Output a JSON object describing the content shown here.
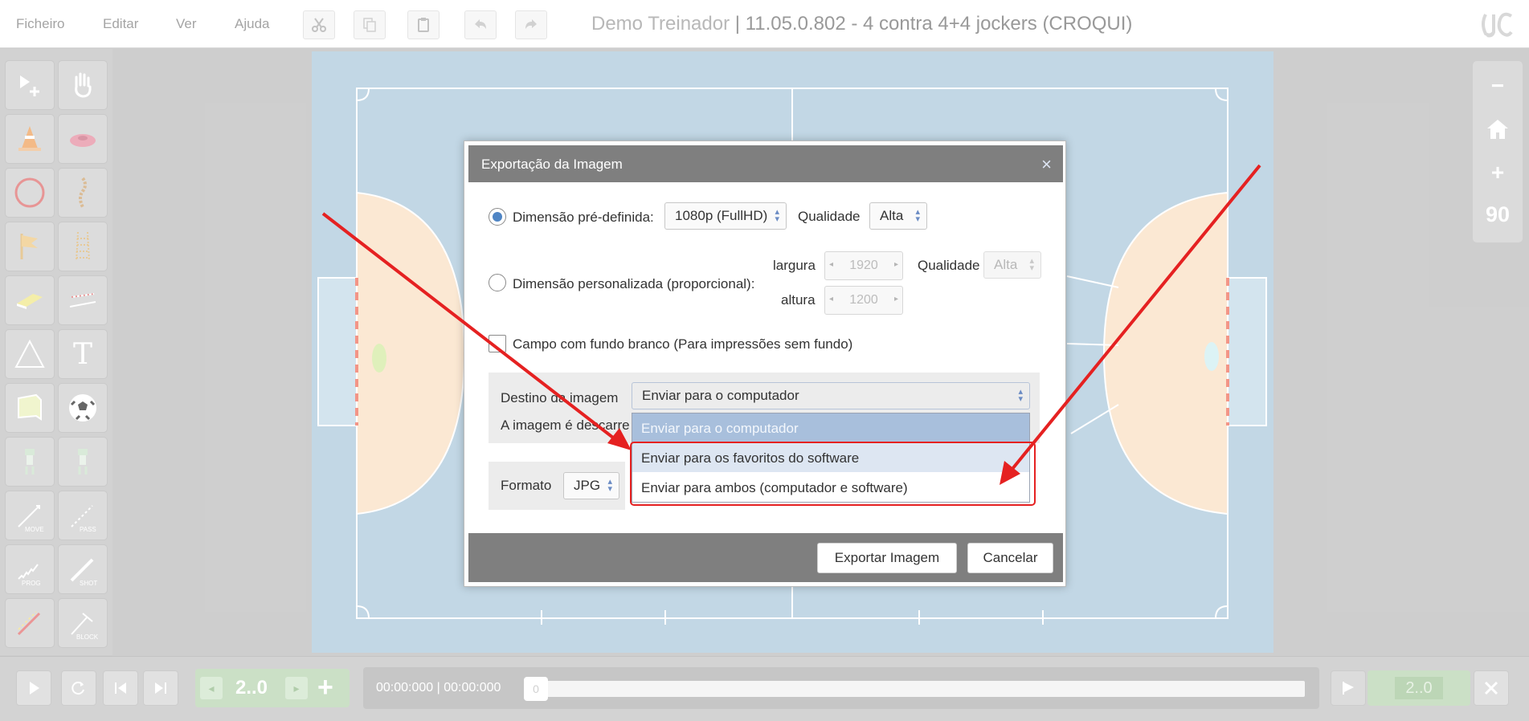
{
  "menu": {
    "file": "Ficheiro",
    "edit": "Editar",
    "view": "Ver",
    "help": "Ajuda"
  },
  "toolbar_icons": [
    "scissors-icon",
    "copy-icon",
    "paste-icon",
    "undo-icon",
    "redo-icon"
  ],
  "title": {
    "app": "Demo Treinador",
    "separator": " | ",
    "doc": "11.05.0.802 - 4 contra 4+4 jockers (CROQUI)"
  },
  "palette": {
    "items": [
      "select-add-icon",
      "hand-icon",
      "cone-icon",
      "disc-icon",
      "circle-icon",
      "ladder-rope-icon",
      "flag-icon",
      "ladder-icon",
      "hurdle-icon",
      "barrier-icon",
      "triangle-icon",
      "text-icon",
      "goal-icon",
      "ball-icon",
      "player-icon",
      "player-alt-icon",
      "move-line-icon",
      "pass-line-icon",
      "prog-line-icon",
      "shot-line-icon",
      "dribble-line-icon",
      "block-line-icon"
    ],
    "labels": {
      "move": "MOVE",
      "pass": "PASS",
      "prog": "PROG",
      "shot": "SHOT",
      "block": "BLOCK",
      "text": "T"
    }
  },
  "zoom": {
    "minus": "−",
    "plus": "+",
    "value": "90"
  },
  "timeline": {
    "frame": "2..0",
    "time": "00:00:000  |  00:00:000",
    "knob": "0",
    "speed": "2..0"
  },
  "dialog": {
    "title": "Exportação da Imagem",
    "close": "×",
    "predefined_label": "Dimensão pré-definida:",
    "predefined_value": "1080p (FullHD)",
    "quality_label": "Qualidade",
    "quality_value": "Alta",
    "custom_label": "Dimensão personalizada (proporcional):",
    "width_label": "largura",
    "width_value": "1920",
    "height_label": "altura",
    "height_value": "1200",
    "custom_quality_label": "Qualidade",
    "custom_quality_value": "Alta",
    "white_bg_label": "Campo com fundo branco (Para impressões sem fundo)",
    "destination_label": "Destino da imagem",
    "destination_value": "Enviar para o computador",
    "destination_options": [
      "Enviar para o computador",
      "Enviar para os favoritos do software",
      "Enviar para ambos (computador e software)"
    ],
    "download_note": "A imagem é descarre",
    "format_label": "Formato",
    "format_value": "JPG",
    "export_button": "Exportar Imagem",
    "cancel_button": "Cancelar"
  },
  "colors": {
    "annotation": "#e52121",
    "court": "#bcd3e3",
    "zone": "#fbe6cf",
    "dialog_header": "#7f7f7f",
    "selected_option": "#a8bfdc"
  }
}
